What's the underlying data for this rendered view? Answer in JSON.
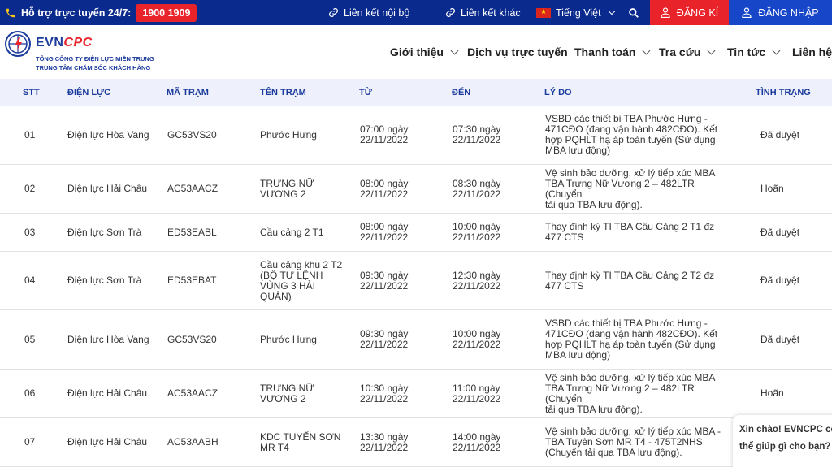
{
  "topbar": {
    "support_label": "Hỗ trợ trực tuyến 24/7:",
    "hotline": "1900 1909",
    "internal_links": "Liên kết nội bộ",
    "other_links": "Liên kết khác",
    "language": "Tiếng Việt",
    "register": "ĐĂNG KÍ",
    "login": "ĐĂNG NHẬP",
    "colors": {
      "bar": "#0a2a8e",
      "register": "#e8232a",
      "login": "#1747c8"
    }
  },
  "header": {
    "brand_a": "EVN",
    "brand_b": "CPC",
    "brand_line1": "TỔNG CÔNG TY ĐIỆN LỰC MIỀN TRUNG",
    "brand_line2": "TRUNG TÂM CHĂM SÓC KHÁCH HÀNG",
    "nav": [
      "Giới thiệu",
      "Dịch vụ trực tuyến",
      "Thanh toán",
      "Tra cứu",
      "Tin tức",
      "Liên hệ"
    ]
  },
  "table": {
    "headers": [
      "STT",
      "ĐIỆN LỰC",
      "MÃ TRẠM",
      "TÊN TRẠM",
      "TỪ",
      "ĐẾN",
      "LÝ DO",
      "TÌNH TRẠNG"
    ],
    "rows": [
      {
        "stt": "01",
        "dien_luc": "Điện lực Hòa Vang",
        "ma_tram": "GC53VS20",
        "ten_tram": [
          "Phước Hưng"
        ],
        "tu": [
          "07:00 ngày",
          "22/11/2022"
        ],
        "den": [
          "07:30 ngày",
          "22/11/2022"
        ],
        "ly_do": [
          "VSBD các thiết bị TBA Phước Hưng -",
          "471CĐO (đang vận hành 482CĐO). Kết",
          "hợp PQHLT hạ áp toàn tuyến (Sử dụng",
          "MBA lưu động)"
        ],
        "tinh_trang": "Đã duyệt"
      },
      {
        "stt": "02",
        "dien_luc": "Điện lực Hải Châu",
        "ma_tram": "AC53AACZ",
        "ten_tram": [
          "TRƯNG NỮ",
          "VƯƠNG 2"
        ],
        "tu": [
          "08:00 ngày",
          "22/11/2022"
        ],
        "den": [
          "08:30 ngày",
          "22/11/2022"
        ],
        "ly_do": [
          "Vệ sinh bảo dưỡng, xử lý tiếp xúc MBA",
          "TBA Trưng Nữ Vương 2 – 482LTR (Chuyển",
          "tải qua TBA lưu động)."
        ],
        "tinh_trang": "Hoãn"
      },
      {
        "stt": "03",
        "dien_luc": "Điện lực Sơn Trà",
        "ma_tram": "ED53EABL",
        "ten_tram": [
          "Cầu cảng 2 T1"
        ],
        "tu": [
          "08:00 ngày",
          "22/11/2022"
        ],
        "den": [
          "10:00 ngày",
          "22/11/2022"
        ],
        "ly_do": [
          "Thay định kỳ TI TBA Cầu Cảng 2 T1 đz",
          "477 CTS"
        ],
        "tinh_trang": "Đã duyệt"
      },
      {
        "stt": "04",
        "dien_luc": "Điện lực Sơn Trà",
        "ma_tram": "ED53EBAT",
        "ten_tram": [
          "Cầu cảng khu 2 T2",
          "(BỘ TƯ LỆNH",
          "VÙNG 3 HẢI",
          "QUÂN)"
        ],
        "tu": [
          "09:30 ngày",
          "22/11/2022"
        ],
        "den": [
          "12:30 ngày",
          "22/11/2022"
        ],
        "ly_do": [
          "Thay định kỳ TI TBA Cầu Cảng 2 T2 đz",
          "477 CTS"
        ],
        "tinh_trang": "Đã duyệt"
      },
      {
        "stt": "05",
        "dien_luc": "Điện lực Hòa Vang",
        "ma_tram": "GC53VS20",
        "ten_tram": [
          "Phước Hưng"
        ],
        "tu": [
          "09:30 ngày",
          "22/11/2022"
        ],
        "den": [
          "10:00 ngày",
          "22/11/2022"
        ],
        "ly_do": [
          "VSBD các thiết bị TBA Phước Hưng -",
          "471CĐO (đang vận hành 482CĐO). Kết",
          "hợp PQHLT hạ áp toàn tuyến (Sử dụng",
          "MBA lưu động)"
        ],
        "tinh_trang": "Đã duyệt"
      },
      {
        "stt": "06",
        "dien_luc": "Điện lực Hải Châu",
        "ma_tram": "AC53AACZ",
        "ten_tram": [
          "TRƯNG NỮ",
          "VƯƠNG 2"
        ],
        "tu": [
          "10:30 ngày",
          "22/11/2022"
        ],
        "den": [
          "11:00 ngày",
          "22/11/2022"
        ],
        "ly_do": [
          "Vệ sinh bảo dưỡng, xử lý tiếp xúc MBA",
          "TBA Trưng Nữ Vương 2 – 482LTR (Chuyển",
          "tải qua TBA lưu động)."
        ],
        "tinh_trang": "Hoãn"
      },
      {
        "stt": "07",
        "dien_luc": "Điện lực Hải Châu",
        "ma_tram": "AC53AABH",
        "ten_tram": [
          "KDC TUYẾN SƠN",
          "MR T4"
        ],
        "tu": [
          "13:30 ngày",
          "22/11/2022"
        ],
        "den": [
          "14:00 ngày",
          "22/11/2022"
        ],
        "ly_do": [
          "Vệ sinh bảo dưỡng, xử lý tiếp xúc MBA -",
          "TBA Tuyên Sơn MR T4 - 475T2NHS",
          "(Chuyển tải qua TBA lưu động)."
        ],
        "tinh_trang": ""
      }
    ]
  },
  "chat": {
    "line1": "Xin chào! EVNCPC có",
    "line2": "thể giúp gì cho bạn?"
  }
}
